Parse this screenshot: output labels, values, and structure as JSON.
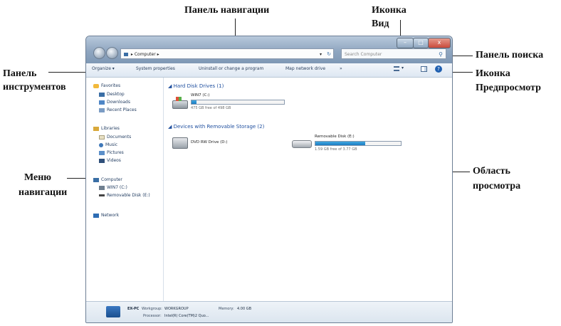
{
  "callouts": {
    "nav_panel": "Панель навигации",
    "view_icon_1": "Иконка",
    "view_icon_2": "Вид",
    "search_panel": "Панель поиска",
    "toolbar_1": "Панель",
    "toolbar_2": "инструментов",
    "preview_icon_1": "Иконка",
    "preview_icon_2": "Предпросмотр",
    "nav_menu_1": "Меню",
    "nav_menu_2": "навигации",
    "view_area_1": "Область",
    "view_area_2": "просмотра"
  },
  "window": {
    "address": "▸ Computer ▸",
    "search_placeholder": "Search Computer",
    "controls": [
      "–",
      "□",
      "x"
    ]
  },
  "toolbar": {
    "items": [
      "Organize ▾",
      "System properties",
      "Uninstall or change a program",
      "Map network drive",
      "»"
    ]
  },
  "sidebar": {
    "favorites": "Favorites",
    "desktop": "Desktop",
    "downloads": "Downloads",
    "recent": "Recent Places",
    "libraries": "Libraries",
    "documents": "Documents",
    "music": "Music",
    "pictures": "Pictures",
    "videos": "Videos",
    "computer": "Computer",
    "win7": "WIN7 (C:)",
    "removable": "Removable Disk (E:)",
    "network": "Network"
  },
  "main": {
    "hdd_group": "Hard Disk Drives (1)",
    "drive_c_name": "WIN7 (C:)",
    "drive_c_free": "475 GB free of 498 GB",
    "drive_c_used": 0.05,
    "removable_group": "Devices with Removable Storage (2)",
    "dvd_name": "DVD RW Drive (D:)",
    "usb_name": "Removable Disk (E:)",
    "usb_free": "1.59 GB free of 3.77 GB",
    "usb_used": 0.58
  },
  "details": {
    "pc_name": "EX-PC",
    "workgroup_label": "Workgroup:",
    "workgroup": "WORKGROUP",
    "memory_label": "Memory:",
    "memory": "4.00 GB",
    "processor_label": "Processor:",
    "processor": "Intel(R) Core(TM)2 Quo..."
  },
  "colors": {
    "accent": "#1d7cc2",
    "titlebar": "#8fa6c0",
    "close_button": "#c94a3b"
  }
}
